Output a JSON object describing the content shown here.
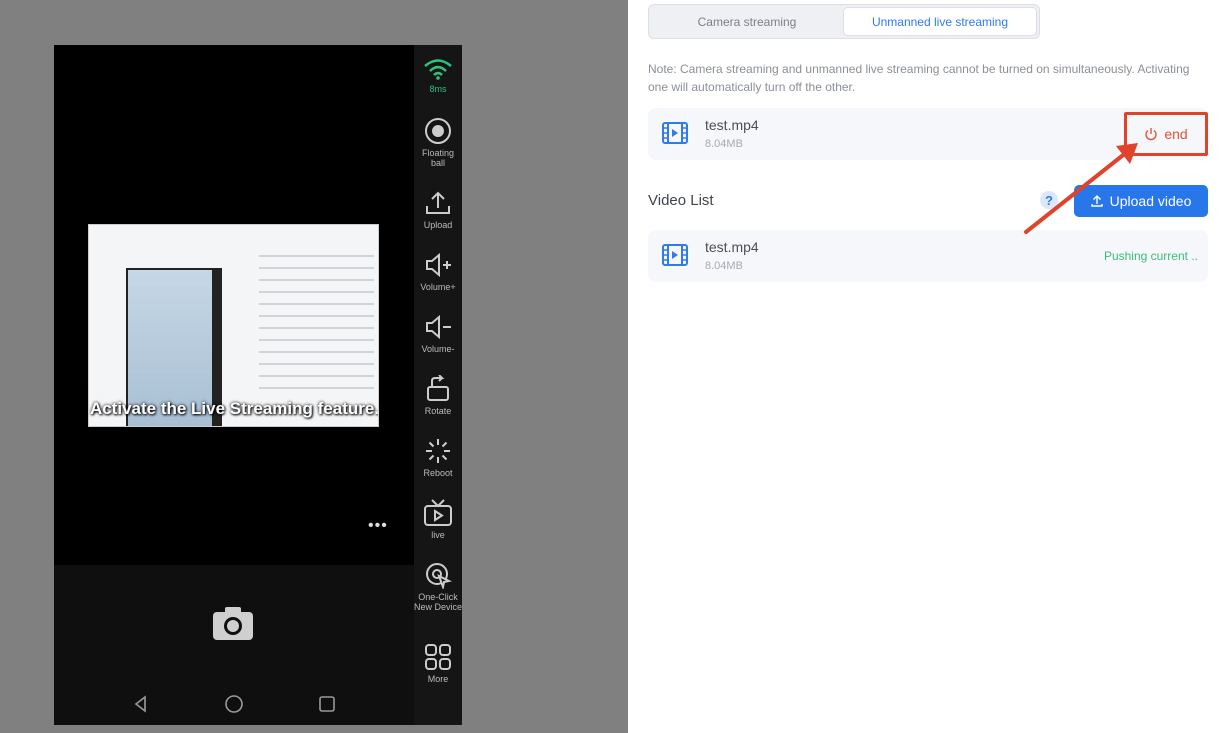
{
  "phone": {
    "overlay_caption": "Activate the Live Streaming feature.",
    "more_label": "•••"
  },
  "toolbar": {
    "latency": "8ms",
    "items": [
      {
        "label": "Floating ball",
        "icon": "floating-ball-icon"
      },
      {
        "label": "Upload",
        "icon": "upload-icon"
      },
      {
        "label": "Volume+",
        "icon": "volume-up-icon"
      },
      {
        "label": "Volume-",
        "icon": "volume-down-icon"
      },
      {
        "label": "Rotate",
        "icon": "rotate-icon"
      },
      {
        "label": "Reboot",
        "icon": "reboot-icon"
      },
      {
        "label": "live",
        "icon": "live-tv-icon"
      },
      {
        "label": "One-Click New Device",
        "icon": "new-device-icon"
      },
      {
        "label": "More",
        "icon": "grid-icon"
      }
    ]
  },
  "panel": {
    "tabs": [
      {
        "label": "Camera streaming",
        "active": false
      },
      {
        "label": "Unmanned live streaming",
        "active": true
      }
    ],
    "note": "Note: Camera streaming and unmanned live streaming cannot be turned on simultaneously. Activating one will automatically turn off the other.",
    "current": {
      "name": "test.mp4",
      "size": "8.04MB",
      "end_label": "end"
    },
    "video_list_title": "Video List",
    "help_label": "?",
    "upload_label": "Upload video",
    "videos": [
      {
        "name": "test.mp4",
        "size": "8.04MB",
        "status": "Pushing current .."
      }
    ]
  },
  "colors": {
    "accent": "#2776ea",
    "danger": "#e0422c",
    "success": "#3dbb7b",
    "wifi": "#2ec27e"
  }
}
